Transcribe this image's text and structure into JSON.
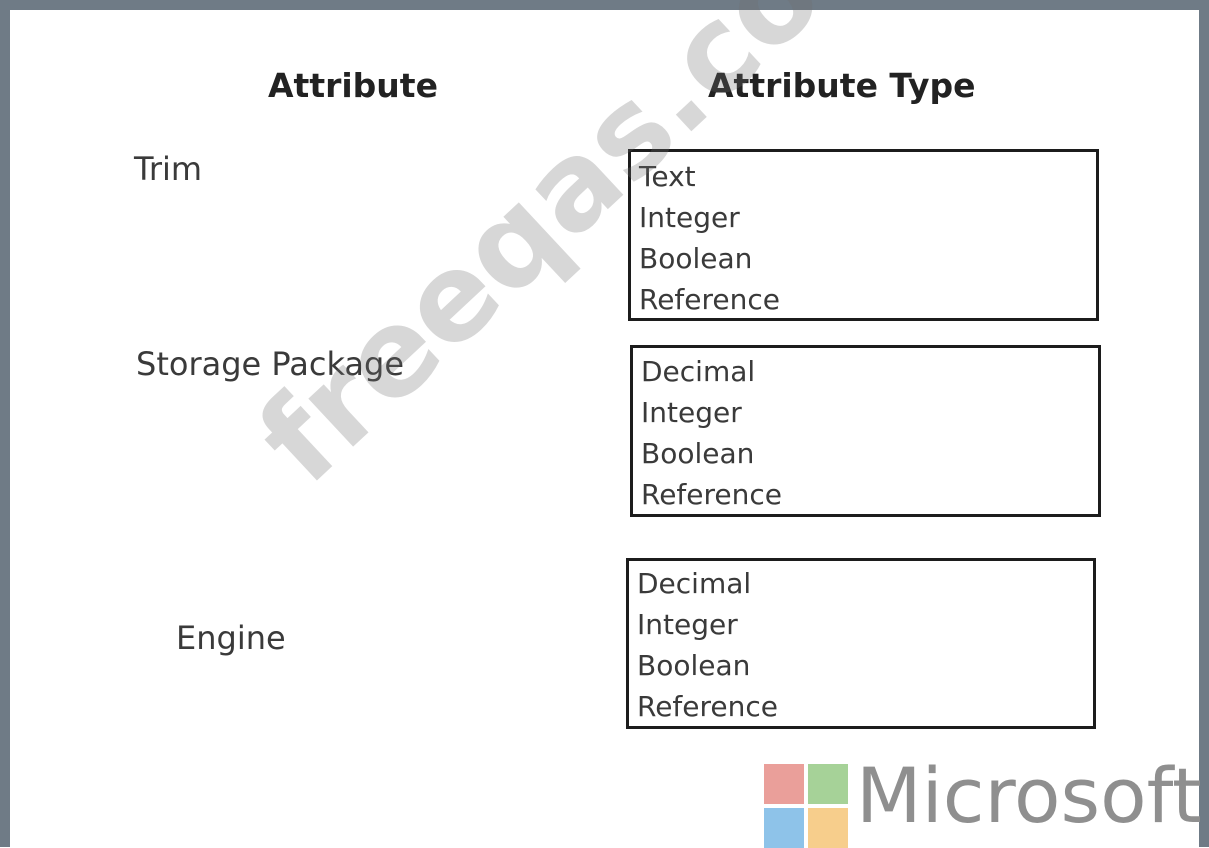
{
  "headers": {
    "attribute": "Attribute",
    "attribute_type": "Attribute Type"
  },
  "rows": [
    {
      "attribute": "Trim",
      "options": [
        "Text",
        "Integer",
        "Boolean",
        "Reference"
      ]
    },
    {
      "attribute": "Storage Package",
      "options": [
        "Decimal",
        "Integer",
        "Boolean",
        "Reference"
      ]
    },
    {
      "attribute": "Engine",
      "options": [
        "Decimal",
        "Integer",
        "Boolean",
        "Reference"
      ]
    }
  ],
  "watermark": "freeqas.com",
  "logo": {
    "text": "Microsoft",
    "colors": [
      "#ea9f9a",
      "#a6d298",
      "#8ec3e9",
      "#f7ce8c"
    ]
  }
}
